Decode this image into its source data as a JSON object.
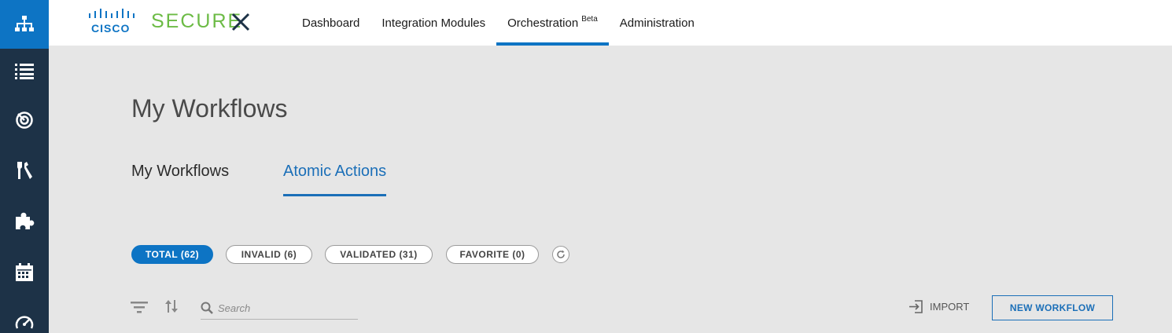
{
  "brand": {
    "cisco_text": "CISCO",
    "product_text": "SECURE",
    "accent_color": "#0d74c4",
    "brand_green": "#6cbb45",
    "rail_color": "#1d3247"
  },
  "rail": {
    "items": [
      {
        "icon": "network-hierarchy-icon"
      },
      {
        "icon": "list-icon"
      },
      {
        "icon": "radar-target-icon"
      },
      {
        "icon": "tools-icon"
      },
      {
        "icon": "puzzle-icon"
      },
      {
        "icon": "calendar-icon"
      },
      {
        "icon": "dashboard-gauge-icon"
      }
    ]
  },
  "nav": {
    "items": [
      {
        "label": "Dashboard"
      },
      {
        "label": "Integration Modules"
      },
      {
        "label": "Orchestration",
        "badge": "Beta",
        "active": true
      },
      {
        "label": "Administration"
      }
    ]
  },
  "page": {
    "title": "My Workflows"
  },
  "tabs": [
    {
      "label": "My Workflows"
    },
    {
      "label": "Atomic Actions",
      "active": true
    }
  ],
  "filters": [
    {
      "label": "TOTAL (62)",
      "active": true
    },
    {
      "label": "INVALID (6)"
    },
    {
      "label": "VALIDATED (31)"
    },
    {
      "label": "FAVORITE (0)"
    }
  ],
  "toolbar": {
    "search_placeholder": "Search",
    "import_label": "IMPORT",
    "new_workflow_label": "NEW WORKFLOW"
  }
}
